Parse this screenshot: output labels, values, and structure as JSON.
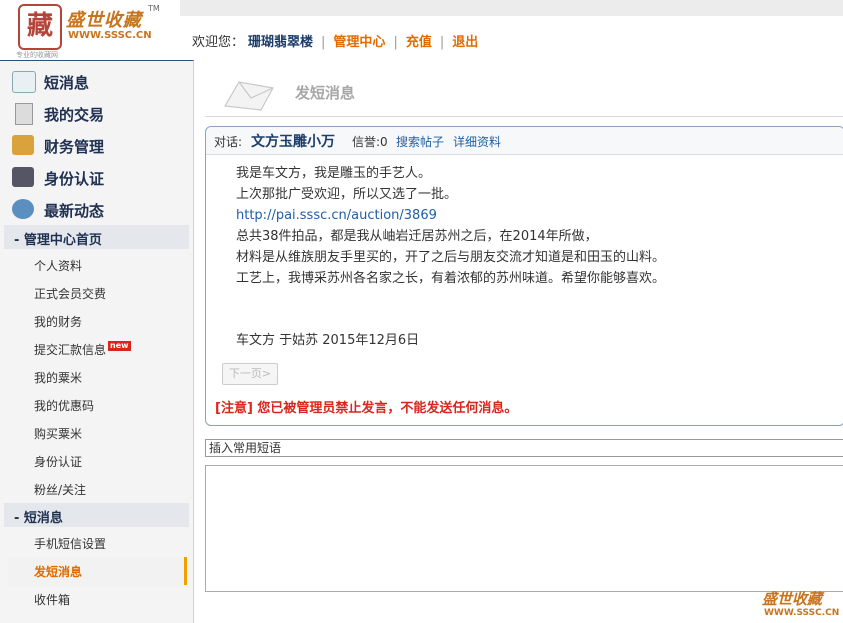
{
  "logo": {
    "seal_char": "藏",
    "brand_name": "盛世收藏",
    "tm": "TM",
    "url": "WWW.SSSC.CN",
    "tagline": "专业的收藏网"
  },
  "topnav": {
    "welcome": "欢迎您：",
    "username": "珊瑚翡翠楼",
    "admin_center": "管理中心",
    "recharge": "充值",
    "logout": "退出"
  },
  "sidebar": {
    "main": [
      {
        "label": "短消息",
        "icon": "message-icon"
      },
      {
        "label": "我的交易",
        "icon": "trade-icon"
      },
      {
        "label": "财务管理",
        "icon": "finance-icon"
      },
      {
        "label": "身份认证",
        "icon": "id-icon"
      },
      {
        "label": "最新动态",
        "icon": "news-icon"
      }
    ],
    "section1_title": "- 管理中心首页",
    "section1_items": [
      "个人资料",
      "正式会员交费",
      "我的财务",
      "提交汇款信息",
      "我的粟米",
      "我的优惠码",
      "购买粟米",
      "身份认证",
      "粉丝/关注"
    ],
    "new_badge": "new",
    "section2_title": "- 短消息",
    "section2_items": [
      "手机短信设置",
      "发短消息",
      "收件箱"
    ],
    "active_item": "发短消息"
  },
  "page": {
    "title": "发短消息"
  },
  "message": {
    "dialog_label": "对话:",
    "partner": "文方玉雕小万",
    "credit": "信誉:0",
    "search_posts": "搜索帖子",
    "details": "详细资料",
    "lines": [
      "我是车文方，我是雕玉的手艺人。",
      "上次那批广受欢迎，所以又选了一批。",
      "http://pai.sssc.cn/auction/3869",
      "总共38件拍品，都是我从岫岩迁居苏州之后，在2014年所做，",
      "材料是从维族朋友手里买的，开了之后与朋友交流才知道是和田玉的山料。",
      "工艺上，我博采苏州各名家之长，有着浓郁的苏州味道。希望你能够喜欢。"
    ],
    "signature": "车文方 于姑苏 2015年12月6日",
    "next_page": "下一页>",
    "warning": "[注意] 您已被管理员禁止发言，不能发送任何消息。"
  },
  "compose": {
    "phrase_select": "插入常用短语",
    "body": ""
  },
  "watermark": {
    "brand": "盛世收藏",
    "url": "WWW.SSSC.CN"
  }
}
